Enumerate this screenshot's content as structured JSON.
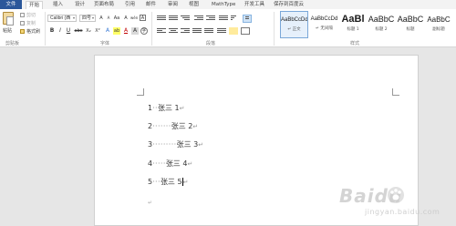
{
  "tabs": [
    "文件",
    "开始",
    "插入",
    "设计",
    "页面布局",
    "引用",
    "邮件",
    "审阅",
    "视图",
    "MathType",
    "开发工具",
    "保存到百度云"
  ],
  "clipboard": {
    "paste_label": "粘贴",
    "cut_label": "剪切",
    "copy_label": "复制",
    "format_painter_label": "格式刷",
    "group_label": "剪贴板"
  },
  "font": {
    "name": "Calibri (西",
    "size": "四号",
    "grow": "A",
    "shrink": "A",
    "case": "Aa",
    "clear": "A",
    "pinyin": "wén",
    "border_char": "A",
    "bold": "B",
    "italic": "I",
    "underline": "U",
    "strike": "abc",
    "subscript": "X₂",
    "superscript": "X²",
    "effects": "A",
    "highlight": "ab",
    "font_color": "A",
    "char_shade": "A",
    "enclosed": "字",
    "group_label": "字体"
  },
  "paragraph": {
    "group_label": "段落"
  },
  "styles": {
    "items": [
      {
        "sample": "AaBbCcDd",
        "name": "↵ 正文"
      },
      {
        "sample": "AaBbCcDd",
        "name": "↵ 无间隔"
      },
      {
        "sample": "AaBl",
        "name": "标题 1"
      },
      {
        "sample": "AaBbC",
        "name": "标题 2"
      },
      {
        "sample": "AaBbC",
        "name": "标题"
      },
      {
        "sample": "AaBbC",
        "name": "副标题"
      }
    ],
    "group_label": "样式"
  },
  "document": {
    "lines": [
      {
        "num": "1",
        "dots": "··",
        "text": "张三 1",
        "mark": "↵"
      },
      {
        "num": "2",
        "dots": "·······",
        "text": "张三 2",
        "mark": "↵"
      },
      {
        "num": "3",
        "dots": "·········",
        "text": "张三 3",
        "mark": "↵"
      },
      {
        "num": "4",
        "dots": "·····",
        "text": "张三 4",
        "mark": "↵"
      },
      {
        "num": "5",
        "dots": "···",
        "text": "张三 5",
        "mark": "↵"
      }
    ],
    "empty_mark": "↵"
  },
  "watermark": {
    "brand": "Baidu",
    "sub": "jingyan.baidu.com"
  },
  "colors": {
    "file_tab": "#2b579a",
    "highlight": "#ffff66",
    "font_color": "#c00000"
  }
}
